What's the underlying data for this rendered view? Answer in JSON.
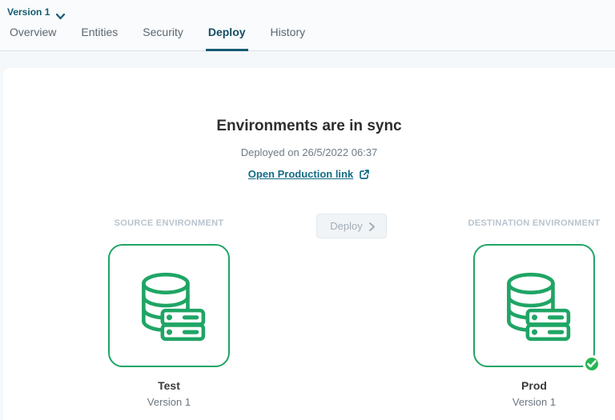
{
  "version": {
    "label": "Version 1"
  },
  "tabs": [
    {
      "label": "Overview",
      "active": false
    },
    {
      "label": "Entities",
      "active": false
    },
    {
      "label": "Security",
      "active": false
    },
    {
      "label": "Deploy",
      "active": true
    },
    {
      "label": "History",
      "active": false
    }
  ],
  "sync": {
    "title": "Environments are in sync",
    "deployed_text": "Deployed on 26/5/2022 06:37",
    "link_label": "Open Production link"
  },
  "deploy": {
    "button_label": "Deploy"
  },
  "source": {
    "section_label": "SOURCE ENVIRONMENT",
    "name": "Test",
    "version": "Version 1",
    "synced_badge": false
  },
  "destination": {
    "section_label": "DESTINATION ENVIRONMENT",
    "name": "Prod",
    "version": "Version 1",
    "synced_badge": true
  },
  "icons": {
    "version_selector": "chevron-down-icon",
    "production_link": "external-link-icon",
    "deploy_button": "chevron-right-icon",
    "environment": "database-icon",
    "synced": "check-badge-icon"
  },
  "colors": {
    "brand_teal": "#155b72",
    "link_teal": "#146c86",
    "env_green": "#1fa565",
    "badge_green": "#28b551",
    "muted_text": "#6f7b84",
    "env_label": "#b9c3cd",
    "page_bg": "#f5f8fa"
  }
}
